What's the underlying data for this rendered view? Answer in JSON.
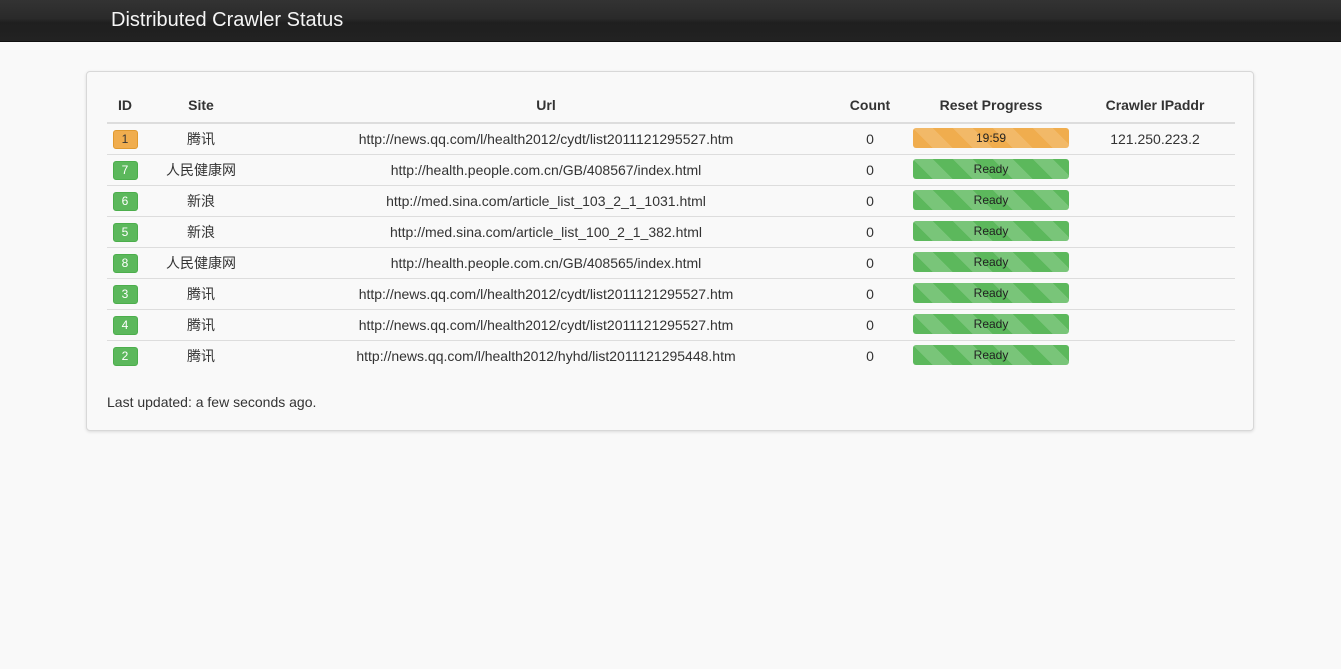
{
  "app": {
    "title": "Distributed Crawler Status"
  },
  "table": {
    "headers": [
      "ID",
      "Site",
      "Url",
      "Count",
      "Reset Progress",
      "Crawler IPaddr"
    ],
    "rows": [
      {
        "id": "1",
        "site": "腾讯",
        "url": "http://news.qq.com/l/health2012/cydt/list2011121295527.htm",
        "count": "0",
        "progress": "19:59",
        "ip": "121.250.223.2",
        "status": "warning"
      },
      {
        "id": "7",
        "site": "人民健康网",
        "url": "http://health.people.com.cn/GB/408567/index.html",
        "count": "0",
        "progress": "Ready",
        "ip": "",
        "status": "success"
      },
      {
        "id": "6",
        "site": "新浪",
        "url": "http://med.sina.com/article_list_103_2_1_1031.html",
        "count": "0",
        "progress": "Ready",
        "ip": "",
        "status": "success"
      },
      {
        "id": "5",
        "site": "新浪",
        "url": "http://med.sina.com/article_list_100_2_1_382.html",
        "count": "0",
        "progress": "Ready",
        "ip": "",
        "status": "success"
      },
      {
        "id": "8",
        "site": "人民健康网",
        "url": "http://health.people.com.cn/GB/408565/index.html",
        "count": "0",
        "progress": "Ready",
        "ip": "",
        "status": "success"
      },
      {
        "id": "3",
        "site": "腾讯",
        "url": "http://news.qq.com/l/health2012/cydt/list2011121295527.htm",
        "count": "0",
        "progress": "Ready",
        "ip": "",
        "status": "success"
      },
      {
        "id": "4",
        "site": "腾讯",
        "url": "http://news.qq.com/l/health2012/cydt/list2011121295527.htm",
        "count": "0",
        "progress": "Ready",
        "ip": "",
        "status": "success"
      },
      {
        "id": "2",
        "site": "腾讯",
        "url": "http://news.qq.com/l/health2012/hyhd/list2011121295448.htm",
        "count": "0",
        "progress": "Ready",
        "ip": "",
        "status": "success"
      }
    ]
  },
  "footer": {
    "last_updated": "Last updated: a few seconds ago."
  },
  "colors": {
    "warning": "#f0ad4e",
    "success": "#5cb85c",
    "navbar": "#222222"
  }
}
